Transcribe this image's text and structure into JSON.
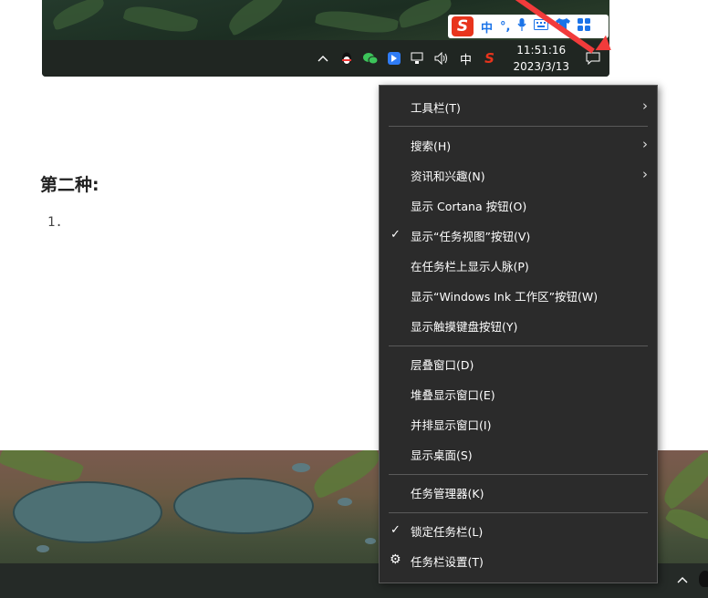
{
  "top_screenshot": {
    "ime_bar": {
      "logo": "S",
      "items": [
        "中",
        "°,",
        "mic-icon",
        "keyboard-icon",
        "shirt-icon",
        "grid-icon"
      ],
      "zh": "中"
    },
    "tray": {
      "input_indicator": "中",
      "sogou_logo": "S"
    },
    "clock": {
      "time": "11:51:16",
      "date": "2023/3/13"
    }
  },
  "document": {
    "heading": "第二种:",
    "list_marker": "1."
  },
  "context_menu": {
    "items": [
      {
        "label": "工具栏(T)",
        "submenu": true
      },
      {
        "label": "搜索(H)",
        "submenu": true
      },
      {
        "label": "资讯和兴趣(N)",
        "submenu": true
      },
      {
        "label": "显示 Cortana 按钮(O)"
      },
      {
        "label": "显示“任务视图”按钮(V)",
        "checked": true
      },
      {
        "label": "在任务栏上显示人脉(P)"
      },
      {
        "label": "显示“Windows Ink 工作区”按钮(W)"
      },
      {
        "label": "显示触摸键盘按钮(Y)"
      },
      {
        "label": "层叠窗口(D)"
      },
      {
        "label": "堆叠显示窗口(E)"
      },
      {
        "label": "并排显示窗口(I)"
      },
      {
        "label": "显示桌面(S)"
      },
      {
        "label": "任务管理器(K)"
      },
      {
        "label": "锁定任务栏(L)",
        "checked": true
      },
      {
        "label": "任务栏设置(T)",
        "icon": "gear-icon"
      }
    ]
  },
  "colors": {
    "menu_bg": "#2b2b2b",
    "accent_red": "#f23b3b",
    "sogou": "#e8341c",
    "ime_blue": "#1a73e8"
  }
}
